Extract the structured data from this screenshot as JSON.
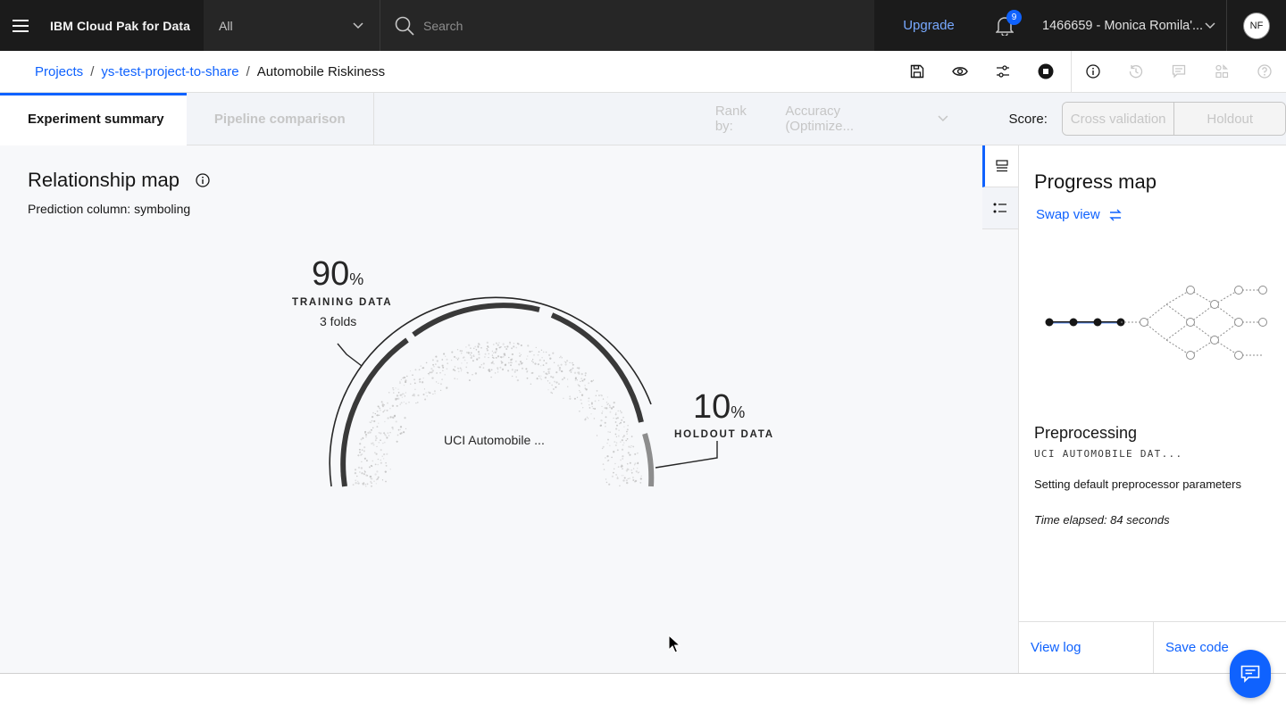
{
  "topbar": {
    "brand": "IBM Cloud Pak for Data",
    "scope": "All",
    "search_placeholder": "Search",
    "upgrade": "Upgrade",
    "notification_count": "9",
    "account": "1466659 - Monica Romila'...",
    "avatar_initials": "NF"
  },
  "breadcrumb": {
    "items": [
      "Projects",
      "ys-test-project-to-share"
    ],
    "separator": "/",
    "current": "Automobile Riskiness"
  },
  "toolbar": {
    "icons": [
      "save-icon",
      "view-icon",
      "settings-icon",
      "stop-icon",
      "information-icon",
      "history-icon",
      "comment-icon",
      "apps-icon",
      "help-icon"
    ]
  },
  "tabs": {
    "active": "Experiment summary",
    "disabled": "Pipeline comparison",
    "rank_by_label": "Rank by:",
    "rank_by_value": "Accuracy (Optimize...",
    "score_label": "Score:",
    "score_options": [
      "Cross validation",
      "Holdout"
    ]
  },
  "relationship_map": {
    "title": "Relationship map",
    "prediction_label": "Prediction column:",
    "prediction_value": "symboling",
    "training_pct": "90",
    "pct_sign": "%",
    "training_caption": "TRAINING DATA",
    "folds": "3 folds",
    "holdout_pct": "10",
    "holdout_caption": "HOLDOUT DATA",
    "dataset": "UCI Automobile ..."
  },
  "progress_map": {
    "title": "Progress map",
    "swap_view": "Swap view",
    "stage": "Preprocessing",
    "stage_dataset": "UCI AUTOMOBILE DAT...",
    "stage_desc": "Setting default preprocessor parameters",
    "elapsed": "Time elapsed: 84 seconds",
    "view_log": "View log",
    "save_code": "Save code"
  },
  "colors": {
    "topbar": "#1b1b1b",
    "accent": "#0f62fe",
    "link": "#0f62fe"
  }
}
